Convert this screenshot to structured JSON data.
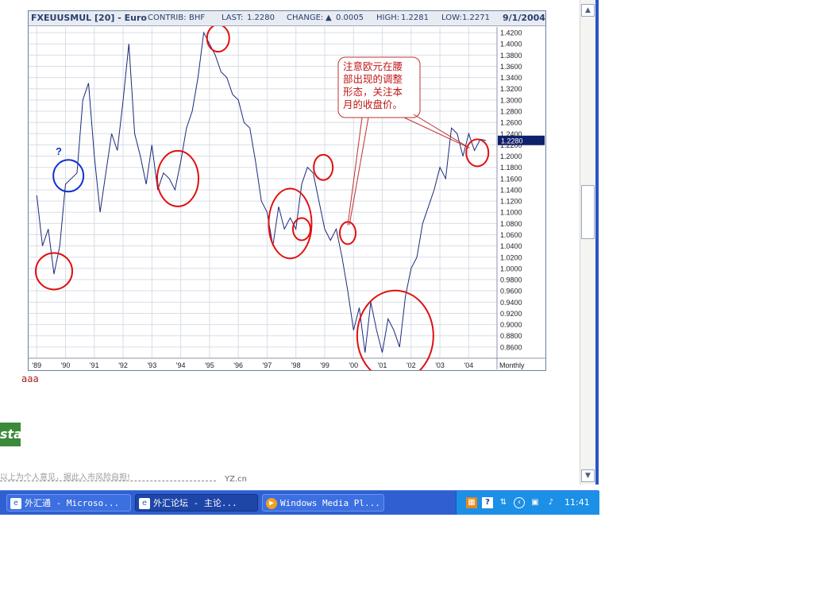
{
  "chart_header": {
    "symbol": "FXEUUSMUL [20] - Euro",
    "contrib_label": "CONTRIB:",
    "contrib_value": "BHF",
    "last_label": "LAST:",
    "last_value": "1.2280",
    "change_label": "CHANGE:",
    "change_value": "0.0005",
    "high_label": "HIGH:",
    "high_value": "1.2281",
    "low_label": "LOW:",
    "low_value": "1.2271",
    "date": "9/1/2004"
  },
  "annotation": {
    "lines": [
      "注意欧元在腰",
      "部出现的调整",
      "形态，关注本",
      "月的收盘价。"
    ],
    "question_mark": "?"
  },
  "chart_data": {
    "type": "line",
    "ylim": [
      0.84,
      1.43
    ],
    "yticks": [
      "1.4200",
      "1.4000",
      "1.3800",
      "1.3600",
      "1.3400",
      "1.3200",
      "1.3000",
      "1.2800",
      "1.2600",
      "1.2400",
      "1.2200",
      "1.2000",
      "1.1800",
      "1.1600",
      "1.1400",
      "1.1200",
      "1.1000",
      "1.0800",
      "1.0600",
      "1.0400",
      "1.0200",
      "1.0000",
      "0.9800",
      "0.9600",
      "0.9400",
      "0.9200",
      "0.9000",
      "0.8800",
      "0.8600"
    ],
    "xticks": [
      "'89",
      "'90",
      "'91",
      "'92",
      "'93",
      "'94",
      "'95",
      "'96",
      "'97",
      "'98",
      "'99",
      "'00",
      "'01",
      "'02",
      "'03",
      "'04"
    ],
    "period_label": "Monthly",
    "last_value_label": "1.2280",
    "series": [
      {
        "x": [
          1989.0,
          1989.2,
          1989.4,
          1989.6,
          1989.8,
          1990.0,
          1990.2,
          1990.4,
          1990.6,
          1990.8,
          1991.0,
          1991.2,
          1991.4,
          1991.6,
          1991.8,
          1992.0,
          1992.2,
          1992.4,
          1992.6,
          1992.8,
          1993.0,
          1993.2,
          1993.4,
          1993.6,
          1993.8,
          1994.0,
          1994.2,
          1994.4,
          1994.6,
          1994.8,
          1995.0,
          1995.2,
          1995.4,
          1995.6,
          1995.8,
          1996.0,
          1996.2,
          1996.4,
          1996.6,
          1996.8,
          1997.0,
          1997.2,
          1997.4,
          1997.6,
          1997.8,
          1998.0,
          1998.2,
          1998.4,
          1998.6,
          1998.8,
          1999.0,
          1999.2,
          1999.4,
          1999.6,
          1999.8,
          2000.0,
          2000.2,
          2000.4,
          2000.6,
          2000.8,
          2001.0,
          2001.2,
          2001.4,
          2001.6,
          2001.8,
          2002.0,
          2002.2,
          2002.4,
          2002.6,
          2002.8,
          2003.0,
          2003.2,
          2003.4,
          2003.6,
          2003.8,
          2004.0,
          2004.2,
          2004.4,
          2004.6
        ],
        "y": [
          1.13,
          1.04,
          1.07,
          0.99,
          1.04,
          1.15,
          1.16,
          1.17,
          1.3,
          1.33,
          1.2,
          1.1,
          1.17,
          1.24,
          1.21,
          1.3,
          1.4,
          1.24,
          1.2,
          1.15,
          1.22,
          1.14,
          1.17,
          1.16,
          1.14,
          1.19,
          1.25,
          1.28,
          1.34,
          1.42,
          1.4,
          1.38,
          1.35,
          1.34,
          1.31,
          1.3,
          1.26,
          1.25,
          1.19,
          1.12,
          1.1,
          1.04,
          1.11,
          1.07,
          1.09,
          1.07,
          1.15,
          1.18,
          1.17,
          1.12,
          1.07,
          1.05,
          1.07,
          1.02,
          0.96,
          0.89,
          0.93,
          0.85,
          0.94,
          0.89,
          0.85,
          0.91,
          0.89,
          0.86,
          0.95,
          1.0,
          1.02,
          1.08,
          1.11,
          1.14,
          1.18,
          1.16,
          1.25,
          1.24,
          1.2,
          1.24,
          1.21,
          1.23,
          1.228
        ]
      }
    ]
  },
  "bottom_text": "aaa",
  "start_fragment": "sta",
  "footer_note": "以上为个人意见，据此入市风险自担!",
  "footer_right": "YZ.cn",
  "taskbar": {
    "tasks": [
      {
        "label": "外汇通 - Microso..."
      },
      {
        "label": "外汇论坛 - 主论..."
      },
      {
        "label": "Windows Media Pl..."
      }
    ],
    "clock": "11:41"
  },
  "colors": {
    "line": "#1a2a7a",
    "circle_red": "#e01010",
    "circle_blue": "#1030d0",
    "taskbar": "#2f5fd0",
    "tray": "#1c8fe6"
  }
}
